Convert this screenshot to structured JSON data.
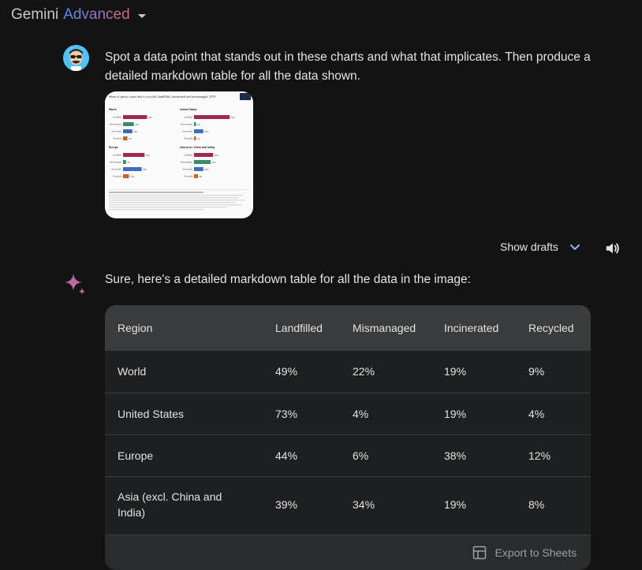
{
  "header": {
    "brand_name": "Gemini",
    "brand_tier": "Advanced"
  },
  "conversation": {
    "user_prompt": "Spot a data point that stands out in these charts and what that implicates. Then produce a detailed markdown table for all the data shown.",
    "attachment": {
      "title": "Share of plastic waste that is recycled, landfilled, incinerated and mismanaged, 2019",
      "panels": [
        {
          "name": "World",
          "labels": [
            "Landfilled",
            "Mismanaged",
            "Incinerated",
            "Recycled"
          ],
          "values": [
            49,
            22,
            19,
            9
          ]
        },
        {
          "name": "United States",
          "labels": [
            "Landfilled",
            "Mismanaged",
            "Incinerated",
            "Recycled"
          ],
          "values": [
            73,
            4,
            19,
            4
          ]
        },
        {
          "name": "Europe",
          "labels": [
            "Landfilled",
            "Mismanaged",
            "Incinerated",
            "Recycled"
          ],
          "values": [
            44,
            6,
            38,
            12
          ]
        },
        {
          "name": "Asia (excl. China and India)",
          "labels": [
            "Landfilled",
            "Mismanaged",
            "Incinerated",
            "Recycled"
          ],
          "values": [
            39,
            34,
            19,
            8
          ]
        }
      ]
    },
    "show_drafts_label": "Show drafts",
    "response_intro": "Sure, here's a detailed markdown table for all the data in the image:",
    "table": {
      "headers": [
        "Region",
        "Landfilled",
        "Mismanaged",
        "Incinerated",
        "Recycled"
      ],
      "rows": [
        [
          "World",
          "49%",
          "22%",
          "19%",
          "9%"
        ],
        [
          "United States",
          "73%",
          "4%",
          "19%",
          "4%"
        ],
        [
          "Europe",
          "44%",
          "6%",
          "38%",
          "12%"
        ],
        [
          "Asia (excl. China and India)",
          "39%",
          "34%",
          "19%",
          "8%"
        ]
      ]
    },
    "export_label": "Export to Sheets"
  },
  "colors": {
    "landfilled": "#9c2a53",
    "mismanaged": "#3d8a6b",
    "incinerated": "#3b6cc4",
    "recycled": "#c4622d",
    "accent_blue": "#8ab4f8"
  },
  "icons": [
    "dropdown-caret-icon",
    "user-avatar-icon",
    "chevron-down-icon",
    "speaker-icon",
    "gemini-sparkle-icon",
    "sheets-icon"
  ]
}
